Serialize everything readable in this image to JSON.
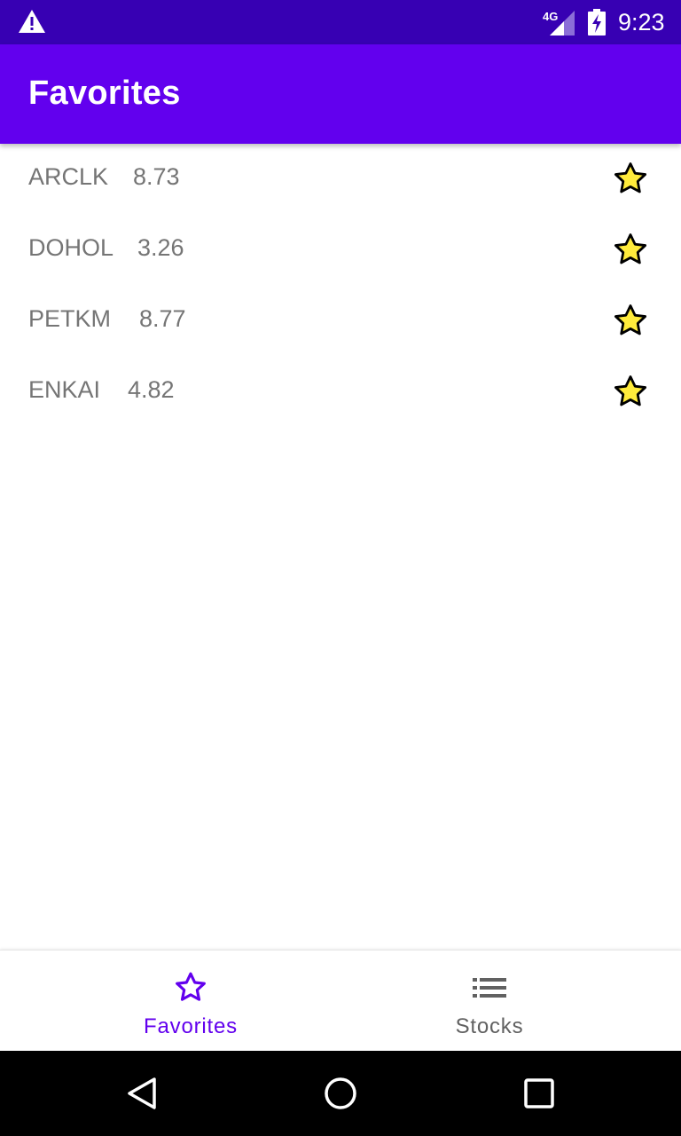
{
  "status_bar": {
    "network_label": "4G",
    "time": "9:23",
    "icons": [
      "warning-icon",
      "signal-icon",
      "battery-charging-icon"
    ]
  },
  "app_bar": {
    "title": "Favorites"
  },
  "favorites": [
    {
      "symbol": "ARCLK",
      "price": "8.73",
      "icon": "star-filled-icon"
    },
    {
      "symbol": "DOHOL",
      "price": "3.26",
      "icon": "star-filled-icon"
    },
    {
      "symbol": "PETKM",
      "price": "8.77",
      "icon": "star-filled-icon"
    },
    {
      "symbol": "ENKAI",
      "price": "4.82",
      "icon": "star-filled-icon"
    }
  ],
  "bottom_nav": {
    "items": [
      {
        "label": "Favorites",
        "icon": "star-outline-icon",
        "selected": true
      },
      {
        "label": "Stocks",
        "icon": "list-icon",
        "selected": false
      }
    ]
  },
  "system_nav": {
    "icons": [
      "back-icon",
      "home-icon",
      "recents-icon"
    ]
  },
  "colors": {
    "status_bar": "#3700b3",
    "app_bar": "#6200ee",
    "accent": "#6200ee",
    "star_fill": "#ffeb3b",
    "text_secondary": "#757575"
  }
}
